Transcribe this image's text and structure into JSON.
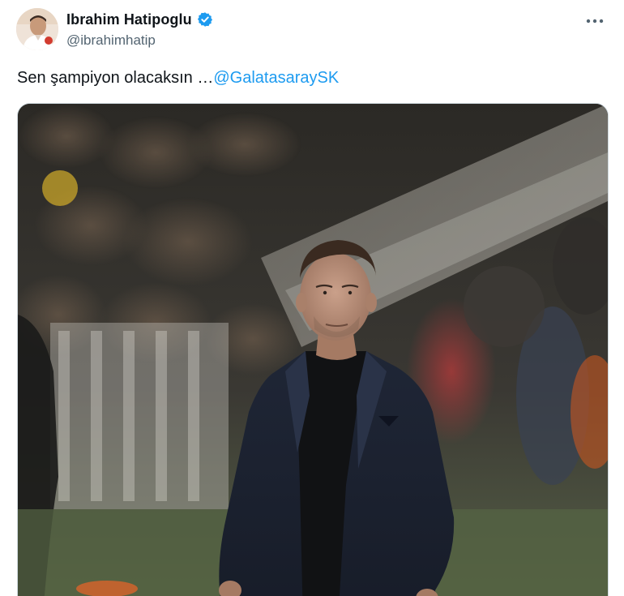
{
  "author": {
    "display_name": "Ibrahim Hatipoglu",
    "handle": "@ibrahimhatip",
    "verified": true,
    "verified_icon": "verified-badge-icon",
    "avatar_icon": "avatar"
  },
  "tweet": {
    "text_prefix": "Sen şampiyon olacaksın …",
    "mention": "@GalatasaraySK"
  },
  "menu": {
    "icon": "more-options-icon"
  },
  "media": {
    "alt": "Coach in a navy blazer and black shirt standing on the sideline with hands in pockets, crowd blurred behind",
    "icon": "photo"
  },
  "colors": {
    "link": "#1d9bf0",
    "text": "#0f1419",
    "muted": "#536471",
    "verified": "#1d9bf0"
  }
}
